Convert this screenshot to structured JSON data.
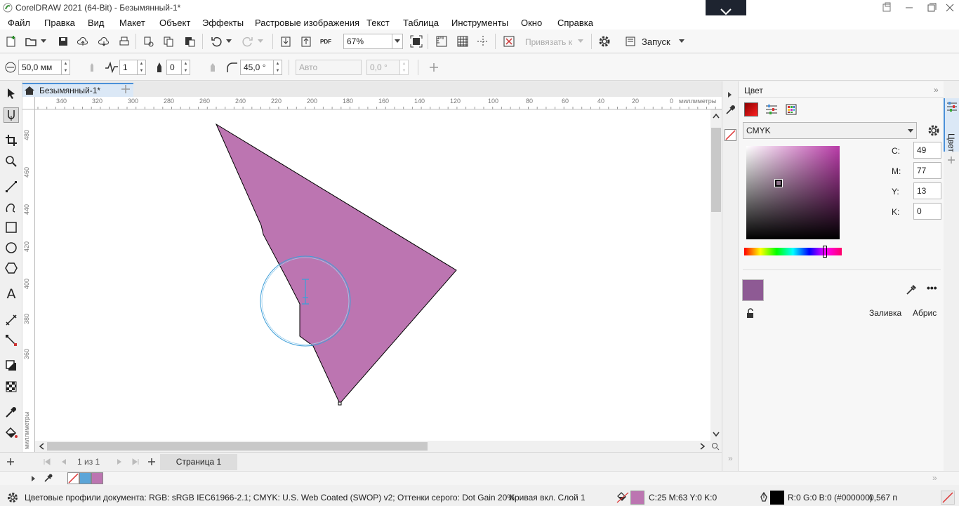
{
  "window": {
    "title": "CorelDRAW 2021 (64-Bit) - Безымянный-1*"
  },
  "menu": [
    "Файл",
    "Правка",
    "Вид",
    "Макет",
    "Объект",
    "Эффекты",
    "Растровые изображения",
    "Текст",
    "Таблица",
    "Инструменты",
    "Окно",
    "Справка"
  ],
  "toolbar": {
    "zoom_value": "67%",
    "snap_label": "Привязать к",
    "launch_label": "Запуск",
    "pdf_label": "PDF"
  },
  "propbar": {
    "width_value": "50,0 мм",
    "points_value": "1",
    "smooth_value": "0",
    "angle_value": "45,0 °",
    "auto_value": "Авто",
    "offset_value": "0,0 °"
  },
  "document": {
    "tab_label": "Безымянный-1*",
    "page_tab": "Страница 1",
    "page_counter": "1 из 1"
  },
  "rulers": {
    "h_unit": "миллиметры",
    "v_unit": "миллиметры",
    "h_ticks": [
      "340",
      "320",
      "300",
      "280",
      "260",
      "240",
      "220",
      "200",
      "180",
      "160",
      "140",
      "120",
      "100",
      "80",
      "60",
      "40",
      "20",
      "0"
    ],
    "v_ticks": [
      "480",
      "460",
      "440",
      "420",
      "400",
      "380",
      "360"
    ]
  },
  "shape": {
    "fill": "#bc75b1",
    "outline": "#000000"
  },
  "docker": {
    "title": "Цвет",
    "model": "CMYK",
    "c_label": "C:",
    "c_value": "49",
    "m_label": "M:",
    "m_value": "77",
    "y_label": "Y:",
    "y_value": "13",
    "k_label": "K:",
    "k_value": "0",
    "swatch_color": "#8e5a94",
    "fill_button": "Заливка",
    "outline_button": "Абрис",
    "side_tab": "Цвет"
  },
  "status": {
    "profiles": "Цветовые профили документа: RGB: sRGB IEC61966-2.1; CMYK: U.S. Web Coated (SWOP) v2; Оттенки серого: Dot Gain 20%",
    "object": "Кривая вкл. Слой 1",
    "fill_value": "C:25 M:63 Y:0 K:0",
    "fill_color": "#bc75b1",
    "outline_value": "R:0 G:0 B:0 (#000000)",
    "outline_width": "0,567 п"
  },
  "palette_colors": [
    "#5ba5d8",
    "#bc75b1"
  ]
}
